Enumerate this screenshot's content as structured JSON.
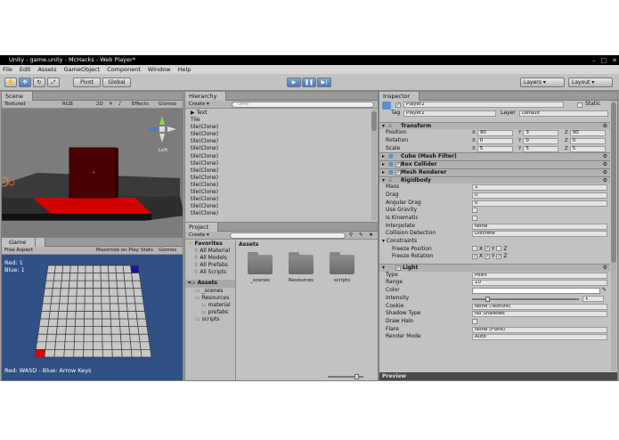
{
  "title": "Unity - game.unity - McHacks - Web Player*",
  "menu": [
    "File",
    "Edit",
    "Assets",
    "GameObject",
    "Component",
    "Window",
    "Help"
  ],
  "toolbar": {
    "pivot": "Pivot",
    "global": "Global",
    "layers": "Layers",
    "layout": "Layout"
  },
  "scene": {
    "tab": "Scene",
    "controls": [
      "Textured",
      "RGB",
      "2D",
      "Effects",
      "Gizmos"
    ],
    "search_placeholder": "Q▾All",
    "gizmo_label": "Left"
  },
  "game": {
    "tab": "Game",
    "aspect": "Free Aspect",
    "controls": [
      "Maximize on Play",
      "Stats",
      "Gizmos"
    ],
    "score_red": "Red: 1",
    "score_blue": "Blue: 1",
    "footer": "Red: WASD - Blue: Arrow Keys",
    "grid_cols": 12,
    "grid_rows": 12,
    "red_cell": [
      0,
      11
    ],
    "blue_cell": [
      11,
      0
    ],
    "colors": {
      "red": "#e00000",
      "blue": "#1a14a0",
      "bg": "#2f5185"
    }
  },
  "hierarchy": {
    "tab": "Hierarchy",
    "create": "Create",
    "search_placeholder": "Q▾All",
    "items": [
      "▶ Text",
      "Tile",
      "tile(Clone)",
      "tile(Clone)",
      "tile(Clone)",
      "tile(Clone)",
      "tile(Clone)",
      "tile(Clone)",
      "tile(Clone)",
      "tile(Clone)",
      "tile(Clone)",
      "tile(Clone)",
      "tile(Clone)",
      "tile(Clone)",
      "tile(Clone)"
    ]
  },
  "project": {
    "tab": "Project",
    "create": "Create",
    "favorites_label": "Favorites",
    "favorites": [
      "All Material",
      "All Models",
      "All Prefabs",
      "All Scripts"
    ],
    "assets_label": "Assets",
    "tree": [
      {
        "label": "_scenes",
        "indent": 1
      },
      {
        "label": "Resources",
        "indent": 1
      },
      {
        "label": "material",
        "indent": 2
      },
      {
        "label": "prefabs",
        "indent": 2
      },
      {
        "label": "scripts",
        "indent": 1
      }
    ],
    "breadcrumb": "Assets",
    "folders": [
      "_scenes",
      "Resources",
      "scripts"
    ]
  },
  "inspector": {
    "tab": "Inspector",
    "name": "Player2",
    "static_label": "Static",
    "tag_label": "Tag",
    "tag_value": "Player2",
    "layer_label": "Layer",
    "layer_value": "Default",
    "transform": {
      "title": "Transform",
      "rows": [
        {
          "label": "Position",
          "x": "90",
          "y": "3",
          "z": "90"
        },
        {
          "label": "Rotation",
          "x": "0",
          "y": "0",
          "z": "0"
        },
        {
          "label": "Scale",
          "x": "5",
          "y": "5",
          "z": "5"
        }
      ]
    },
    "components": [
      "Cube (Mesh Filter)",
      "Box Collider",
      "Mesh Renderer"
    ],
    "rigidbody": {
      "title": "Rigidbody",
      "rows": [
        {
          "label": "Mass",
          "value": "1"
        },
        {
          "label": "Drag",
          "value": "0"
        },
        {
          "label": "Angular Drag",
          "value": "0"
        },
        {
          "label": "Use Gravity",
          "value": ""
        },
        {
          "label": "Is Kinematic",
          "value": ""
        },
        {
          "label": "Interpolate",
          "value": "None"
        },
        {
          "label": "Collision Detection",
          "value": "Discrete"
        }
      ],
      "constraints_label": "Constraints",
      "freeze_position": "Freeze Position",
      "freeze_rotation": "Freeze Rotation"
    },
    "light": {
      "title": "Light",
      "rows": [
        {
          "label": "Type",
          "value": "Point"
        },
        {
          "label": "Range",
          "value": "10"
        },
        {
          "label": "Color",
          "value": ""
        },
        {
          "label": "Intensity",
          "value": "1"
        },
        {
          "label": "Cookie",
          "value": "None (Texture)"
        },
        {
          "label": "Shadow Type",
          "value": "No Shadows"
        },
        {
          "label": "Draw Halo",
          "value": ""
        },
        {
          "label": "Flare",
          "value": "None (Flare)"
        },
        {
          "label": "Render Mode",
          "value": "Auto"
        }
      ]
    },
    "preview": "Preview"
  }
}
